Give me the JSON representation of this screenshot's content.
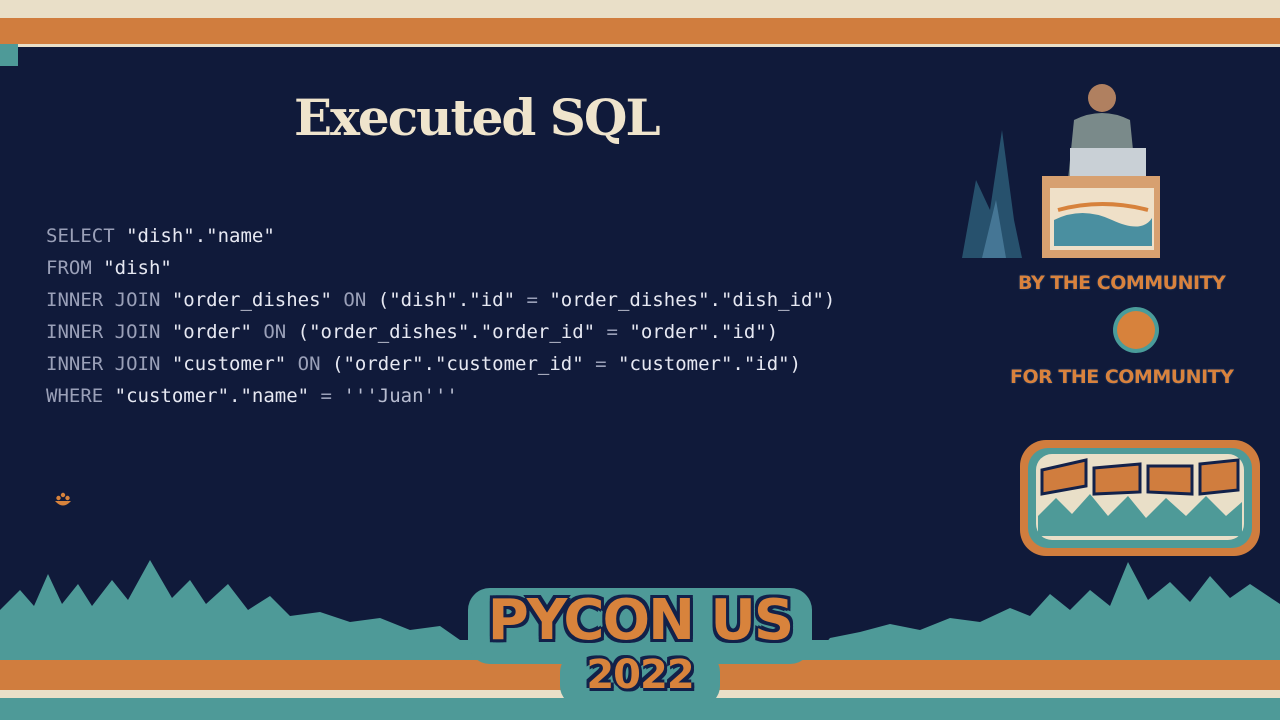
{
  "slide": {
    "title": "Executed SQL"
  },
  "sql": {
    "lines": [
      [
        {
          "t": "SELECT",
          "c": "kw"
        },
        {
          "t": " \"dish\".\"name\"",
          "c": "plain"
        }
      ],
      [
        {
          "t": "FROM",
          "c": "kw"
        },
        {
          "t": " \"dish\"",
          "c": "plain"
        }
      ],
      [
        {
          "t": "INNER JOIN",
          "c": "kw"
        },
        {
          "t": " \"order_dishes\" ",
          "c": "plain"
        },
        {
          "t": "ON",
          "c": "kw"
        },
        {
          "t": " (\"dish\".\"id\" ",
          "c": "plain"
        },
        {
          "t": "=",
          "c": "op"
        },
        {
          "t": " \"order_dishes\".\"dish_id\")",
          "c": "plain"
        }
      ],
      [
        {
          "t": "INNER JOIN",
          "c": "kw"
        },
        {
          "t": " \"order\" ",
          "c": "plain"
        },
        {
          "t": "ON",
          "c": "kw"
        },
        {
          "t": " (\"order_dishes\".\"order_id\" ",
          "c": "plain"
        },
        {
          "t": "=",
          "c": "op"
        },
        {
          "t": " \"order\".\"id\")",
          "c": "plain"
        }
      ],
      [
        {
          "t": "INNER JOIN",
          "c": "kw"
        },
        {
          "t": " \"customer\" ",
          "c": "plain"
        },
        {
          "t": "ON",
          "c": "kw"
        },
        {
          "t": " (\"order\".\"customer_id\" ",
          "c": "plain"
        },
        {
          "t": "=",
          "c": "op"
        },
        {
          "t": " \"customer\".\"id\")",
          "c": "plain"
        }
      ],
      [
        {
          "t": "WHERE",
          "c": "kw"
        },
        {
          "t": " \"customer\".\"name\" ",
          "c": "plain"
        },
        {
          "t": "=",
          "c": "op"
        },
        {
          "t": " '''Juan'''",
          "c": "str"
        }
      ]
    ]
  },
  "sidebar": {
    "tagline_top": "BY THE COMMUNITY",
    "tagline_bottom": "FOR THE COMMUNITY"
  },
  "footer": {
    "event_name": "PYCON US",
    "event_year": "2022"
  },
  "colors": {
    "background": "#101a3a",
    "accent_orange": "#d07d3e",
    "accent_teal": "#4e9a98",
    "cream": "#e9dfc8"
  },
  "icons": [
    "python-logo-icon",
    "conference-badge-logo",
    "speaker-video"
  ]
}
